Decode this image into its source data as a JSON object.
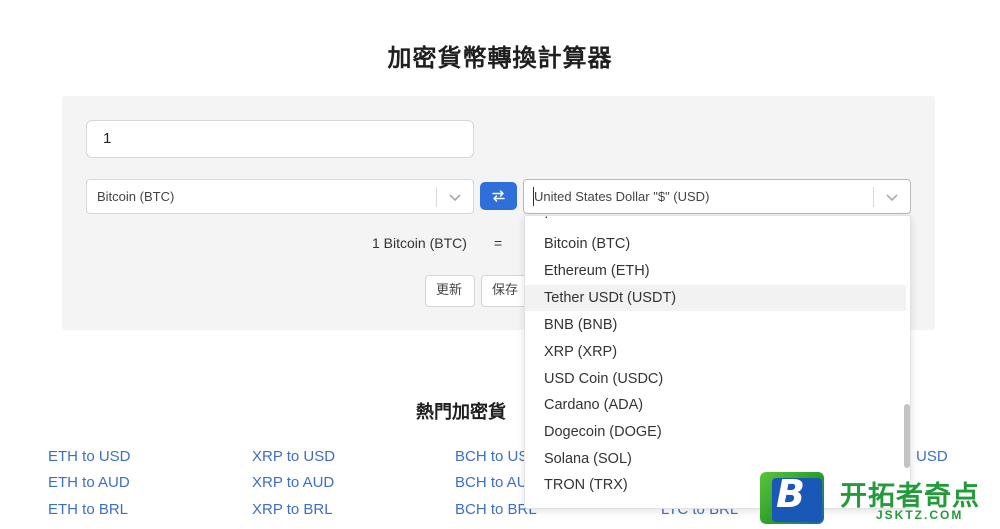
{
  "page_title": "加密貨幣轉換計算器",
  "converter": {
    "amount": "1",
    "from_currency": "Bitcoin (BTC)",
    "to_currency": "United States Dollar \"$\" (USD)",
    "result_left": "1 Bitcoin (BTC)",
    "equals": "=",
    "update_label": "更新",
    "save_label": "保存"
  },
  "dropdown": {
    "options": [
      "Bitcoin (BTC)",
      "Ethereum (ETH)",
      "Tether USDt (USDT)",
      "BNB (BNB)",
      "XRP (XRP)",
      "USD Coin (USDC)",
      "Cardano (ADA)",
      "Dogecoin (DOGE)",
      "Solana (SOL)",
      "TRON (TRX)"
    ],
    "highlighted_index": 2
  },
  "popular": {
    "title": "熱門加密貨",
    "columns": [
      [
        "ETH to USD",
        "ETH to AUD",
        "ETH to BRL"
      ],
      [
        "XRP to USD",
        "XRP to AUD",
        "XRP to BRL"
      ],
      [
        "BCH to USD",
        "BCH to AUD",
        "BCH to BRL"
      ]
    ],
    "right_peek": "USD",
    "partial_bottom": "LTC to BRL"
  },
  "watermark": {
    "letter": "B",
    "text_cn": "开拓者奇点",
    "text_en": "JSKTZ.COM"
  },
  "colors": {
    "accent": "#2f6fd9",
    "link": "#3d6fc6",
    "panel_bg": "#f4f4f4",
    "watermark_green": "#239b3a"
  }
}
